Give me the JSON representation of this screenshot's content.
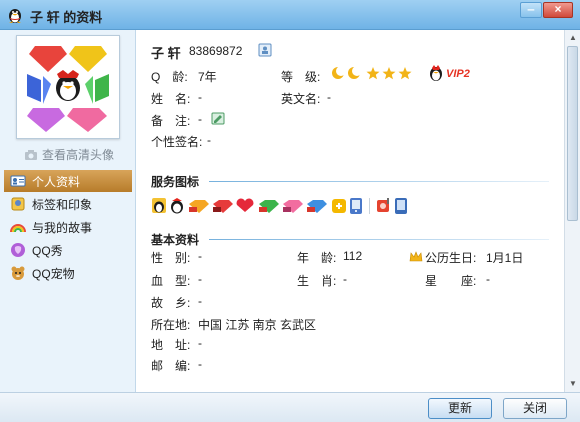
{
  "window": {
    "title": "子 轩 的资料"
  },
  "sidebar": {
    "hd_link": "查看高清头像",
    "items": [
      {
        "label": "个人资料",
        "icon": "profile-card-icon",
        "active": true
      },
      {
        "label": "标签和印象",
        "icon": "tag-icon"
      },
      {
        "label": "与我的故事",
        "icon": "rainbow-icon"
      },
      {
        "label": "QQ秀",
        "icon": "qq-show-icon"
      },
      {
        "label": "QQ宠物",
        "icon": "qq-pet-icon"
      }
    ]
  },
  "profile": {
    "name": "子 轩",
    "qq_number": "83869872",
    "age_label": "Q　龄:",
    "age_value": "7年",
    "level_label": "等　级:",
    "vip": "VIP2",
    "surname_label": "姓　名:",
    "surname_value": "-",
    "english_name_label": "英文名:",
    "english_name_value": "-",
    "note_label": "备　注:",
    "note_value": "-",
    "signature_label": "个性签名:",
    "signature_value": "-"
  },
  "services": {
    "title": "服务图标",
    "icons": [
      "qq-penguin-icon",
      "qq-red-penguin-icon",
      "yellow-diamond-icon",
      "red-diamond-icon",
      "heart-icon",
      "green-diamond-icon",
      "pink-diamond-icon",
      "blue-diamond-icon",
      "qq-game-icon",
      "phone-icon",
      "music-icon",
      "mobile-icon"
    ]
  },
  "basic": {
    "title": "基本资料",
    "gender_label": "性　别:",
    "gender_value": "-",
    "age_label": "年　龄:",
    "age_value": "112",
    "birthday_label": "公历生日:",
    "birthday_value": "1月1日",
    "blood_label": "血　型:",
    "blood_value": "-",
    "zodiac_label": "生　肖:",
    "zodiac_value": "-",
    "constellation_label": "星　　座:",
    "constellation_value": "-",
    "hometown_label": "故　乡:",
    "hometown_value": "-",
    "location_label": "所在地:",
    "location_value": "中国 江苏 南京 玄武区",
    "address_label": "地　址:",
    "address_value": "-",
    "postcode_label": "邮　编:",
    "postcode_value": "-"
  },
  "footer": {
    "refresh": "更新",
    "close": "关闭"
  }
}
